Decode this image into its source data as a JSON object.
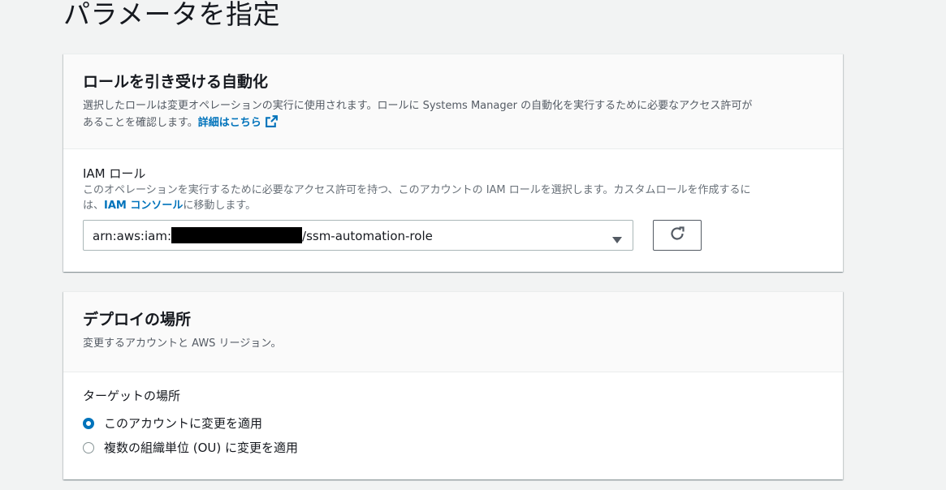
{
  "page": {
    "title": "パラメータを指定"
  },
  "role_panel": {
    "heading": "ロールを引き受ける自動化",
    "desc_line1": "選択したロールは変更オペレーションの実行に使用されます。ロールに Systems Manager の自動化を実行するために必要なアクセス許可が",
    "desc_line2": "あることを確認します。",
    "learn_more": "詳細はこちら",
    "field_label": "IAM ロール",
    "field_desc_line1": "このオペレーションを実行するために必要なアクセス許可を持つ、このアカウントの IAM ロールを選択します。カスタムロールを作成するに",
    "field_desc_line2_prefix": "は、",
    "console_link": "IAM コンソール",
    "field_desc_line2_suffix": "に移動します。",
    "select_prefix": "arn:aws:iam:",
    "select_suffix": "/ssm-automation-role"
  },
  "deploy_panel": {
    "heading": "デプロイの場所",
    "desc": "変更するアカウントと AWS リージョン。",
    "field_label": "ターゲットの場所",
    "options": [
      {
        "label": "このアカウントに変更を適用",
        "checked": true
      },
      {
        "label": "複数の組織単位 (OU) に変更を適用",
        "checked": false
      }
    ]
  },
  "colors": {
    "link": "#0073bb",
    "radio_selected": "#0073bb"
  },
  "icons": {
    "external_link": "external-link-icon",
    "caret": "caret-down-icon",
    "refresh": "refresh-icon"
  }
}
